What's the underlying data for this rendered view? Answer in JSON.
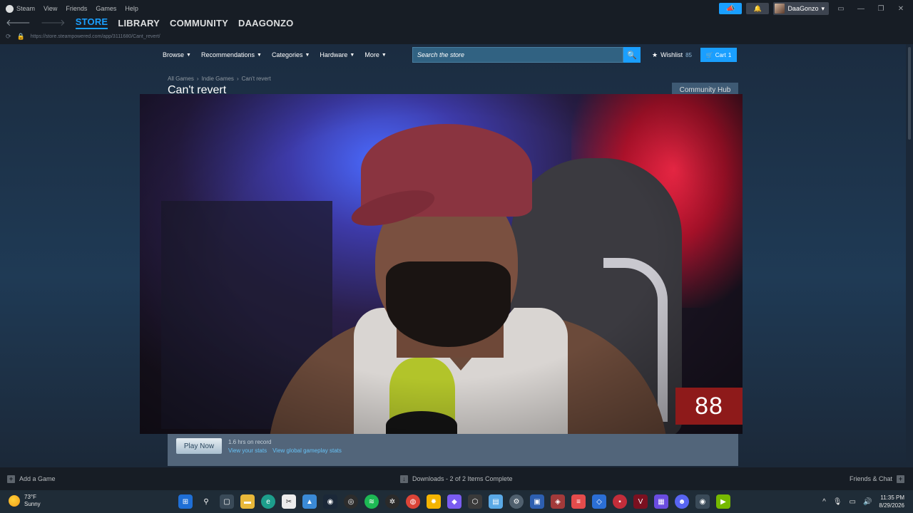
{
  "window": {
    "menu": [
      "Steam",
      "View",
      "Friends",
      "Games",
      "Help"
    ],
    "username": "DaaGonzo",
    "nav_tabs": [
      "STORE",
      "LIBRARY",
      "COMMUNITY",
      "DAAGONZO"
    ],
    "url": "https://store.steampowered.com/app/3111680/Cant_revert/"
  },
  "store": {
    "nav": [
      "Browse",
      "Recommendations",
      "Categories",
      "Hardware",
      "More"
    ],
    "search_placeholder": "Search the store",
    "wishlist_label": "Wishlist",
    "wishlist_count": "85",
    "cart_label": "Cart",
    "cart_count": "1",
    "breadcrumb": [
      "All Games",
      "Indie Games",
      "Can't revert"
    ],
    "game_title": "Can't revert",
    "community_hub": "Community Hub",
    "play_now": "Play Now",
    "hours_on_record": "1.6 hrs on record",
    "view_stats": "View your stats",
    "view_global_stats": "View global gameplay stats"
  },
  "overlay": {
    "counter": "88"
  },
  "bottombar": {
    "add_game": "Add a Game",
    "downloads": "Downloads - 2 of 2 Items Complete",
    "friends_chat": "Friends & Chat"
  },
  "taskbar": {
    "temperature": "73°F",
    "condition": "Sunny",
    "time": "11:35 PM",
    "date": "8/29/2026",
    "apps": [
      "windows-start",
      "search",
      "task-view",
      "file-explorer",
      "edge",
      "snipping-tool",
      "photos",
      "steam",
      "obs",
      "spotify",
      "chatgpt",
      "chrome",
      "sticky-notes",
      "copilot",
      "box-app",
      "notepad",
      "settings",
      "remote-desktop",
      "game-app",
      "todoist",
      "vscode-like",
      "red-app",
      "adobe-app",
      "grid-app",
      "discord",
      "steam-active",
      "nvidia-app"
    ],
    "colors": {
      "accent": "#1a9fff",
      "store_bg": "#1b2838",
      "counter_bg": "#8e1a1a"
    }
  }
}
